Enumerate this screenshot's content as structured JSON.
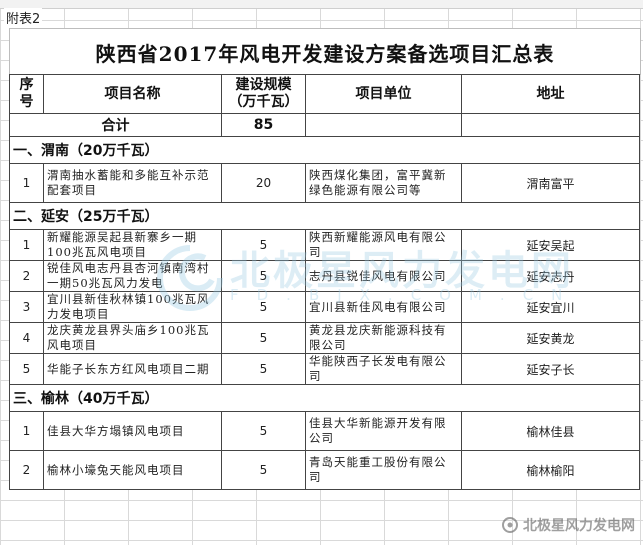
{
  "attachment_label": "附表2",
  "title": "陕西省2017年风电开发建设方案备选项目汇总表",
  "headers": {
    "seq": "序号",
    "name": "项目名称",
    "scale": "建设规模（万千瓦）",
    "unit": "项目单位",
    "address": "地址"
  },
  "total": {
    "label": "合计",
    "value": "85"
  },
  "sections": [
    {
      "title": "一、渭南（20万千瓦）",
      "rows": [
        {
          "seq": "1",
          "name": "渭南抽水蓄能和多能互补示范配套项目",
          "scale": "20",
          "unit": "陕西煤化集团，富平冀新绿色能源有限公司等",
          "address": "渭南富平"
        }
      ]
    },
    {
      "title": "二、延安（25万千瓦）",
      "rows": [
        {
          "seq": "1",
          "name": "新耀能源吴起县新寨乡一期100兆瓦风电项目",
          "scale": "5",
          "unit": "陕西新耀能源风电有限公司",
          "address": "延安吴起"
        },
        {
          "seq": "2",
          "name": "锐佳风电志丹县杏河镇南湾村一期50兆瓦风力发电",
          "scale": "5",
          "unit": "志丹县锐佳风电有限公司",
          "address": "延安志丹"
        },
        {
          "seq": "3",
          "name": "宜川县新佳秋林镇100兆瓦风力发电项目",
          "scale": "5",
          "unit": "宜川县新佳风电有限公司",
          "address": "延安宜川"
        },
        {
          "seq": "4",
          "name": "龙庆黄龙县界头庙乡100兆瓦风电项目",
          "scale": "5",
          "unit": "黄龙县龙庆新能源科技有限公司",
          "address": "延安黄龙"
        },
        {
          "seq": "5",
          "name": "华能子长东方红风电项目二期",
          "scale": "5",
          "unit": "华能陕西子长发电有限公司",
          "address": "延安子长"
        }
      ]
    },
    {
      "title": "三、榆林（40万千瓦）",
      "rows": [
        {
          "seq": "1",
          "name": "佳县大华方塌镇风电项目",
          "scale": "5",
          "unit": "佳县大华新能源开发有限公司",
          "address": "榆林佳县"
        },
        {
          "seq": "2",
          "name": "榆林小壕兔天能风电项目",
          "scale": "5",
          "unit": "青岛天能重工股份有限公司",
          "address": "榆林榆阳"
        }
      ]
    }
  ],
  "watermark": {
    "main": "北极星风力发电网",
    "sub": "FD.BJX.COM.CN",
    "corner": "北极星风力发电网"
  }
}
